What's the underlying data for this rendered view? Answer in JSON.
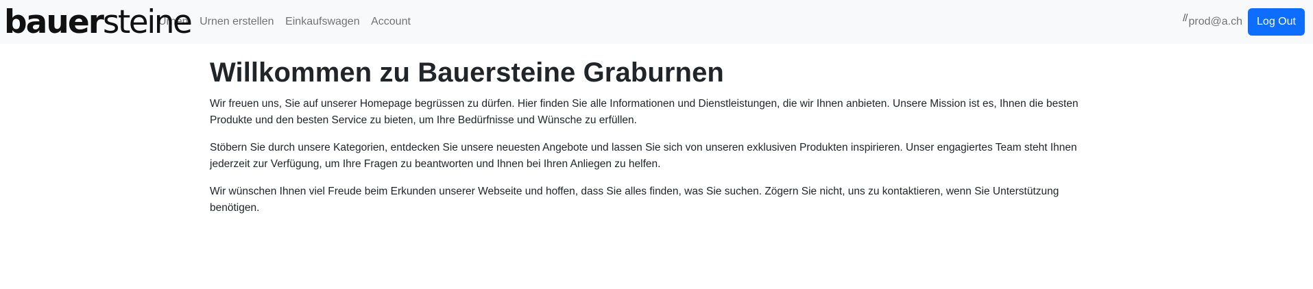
{
  "brand": {
    "part_bold": "bauer",
    "part_light": "steine"
  },
  "nav": {
    "links": [
      {
        "label": "Urnen"
      },
      {
        "label": "Urnen erstellen"
      },
      {
        "label": "Einkaufswagen"
      },
      {
        "label": "Account"
      }
    ]
  },
  "user": {
    "icon": "//",
    "email": "prod@a.ch",
    "logout_label": "Log Out"
  },
  "main": {
    "title": "Willkommen zu Bauersteine Graburnen",
    "paragraphs": [
      "Wir freuen uns, Sie auf unserer Homepage begrüssen zu dürfen. Hier finden Sie alle Informationen und Dienstleistungen, die wir Ihnen anbieten. Unsere Mission ist es, Ihnen die besten Produkte und den besten Service zu bieten, um Ihre Bedürfnisse und Wünsche zu erfüllen.",
      "Stöbern Sie durch unsere Kategorien, entdecken Sie unsere neuesten Angebote und lassen Sie sich von unseren exklusiven Produkten inspirieren. Unser engagiertes Team steht Ihnen jederzeit zur Verfügung, um Ihre Fragen zu beantworten und Ihnen bei Ihren Anliegen zu helfen.",
      "Wir wünschen Ihnen viel Freude beim Erkunden unserer Webseite und hoffen, dass Sie alles finden, was Sie suchen. Zögern Sie nicht, uns zu kontaktieren, wenn Sie Unterstützung benötigen."
    ]
  },
  "colors": {
    "navbar_bg": "#f8f9fa",
    "primary": "#0d6efd",
    "text": "#212529"
  }
}
